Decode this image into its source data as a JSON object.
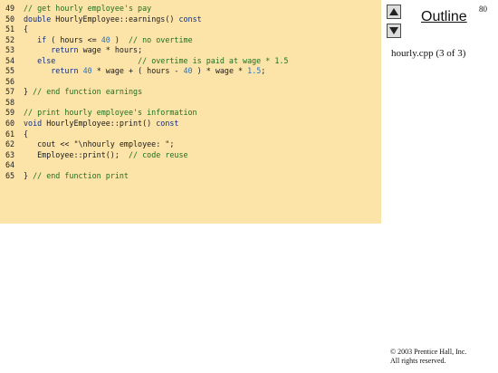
{
  "slide": {
    "page_number": "80"
  },
  "outline": {
    "title": "Outline",
    "file_caption": "hourly.cpp (3 of 3)"
  },
  "navigation": {
    "up_icon": "triangle-up-icon",
    "down_icon": "triangle-down-icon"
  },
  "colors": {
    "code_background": "#fce3a8",
    "comment": "#1f6f1f",
    "number": "#2a73b8",
    "keyword": "#102e80"
  },
  "code": {
    "lines": [
      {
        "num": "49",
        "text": "// get hourly employee's pay"
      },
      {
        "num": "50",
        "text": "double HourlyEmployee::earnings() const"
      },
      {
        "num": "51",
        "text": "{"
      },
      {
        "num": "52",
        "text": "   if ( hours <= 40 )  // no overtime"
      },
      {
        "num": "53",
        "text": "      return wage * hours;"
      },
      {
        "num": "54",
        "text": "   else                  // overtime is paid at wage * 1.5"
      },
      {
        "num": "55",
        "text": "      return 40 * wage + ( hours - 40 ) * wage * 1.5;"
      },
      {
        "num": "56",
        "text": ""
      },
      {
        "num": "57",
        "text": "} // end function earnings"
      },
      {
        "num": "58",
        "text": ""
      },
      {
        "num": "59",
        "text": "// print hourly employee's information"
      },
      {
        "num": "60",
        "text": "void HourlyEmployee::print() const"
      },
      {
        "num": "61",
        "text": "{"
      },
      {
        "num": "62",
        "text": "   cout << \"\\nhourly employee: \";"
      },
      {
        "num": "63",
        "text": "   Employee::print();  // code reuse"
      },
      {
        "num": "64",
        "text": ""
      },
      {
        "num": "65",
        "text": "} // end function print"
      }
    ]
  },
  "footer": {
    "copyright_line1": "© 2003 Prentice Hall, Inc.",
    "copyright_line2": "All rights reserved."
  }
}
